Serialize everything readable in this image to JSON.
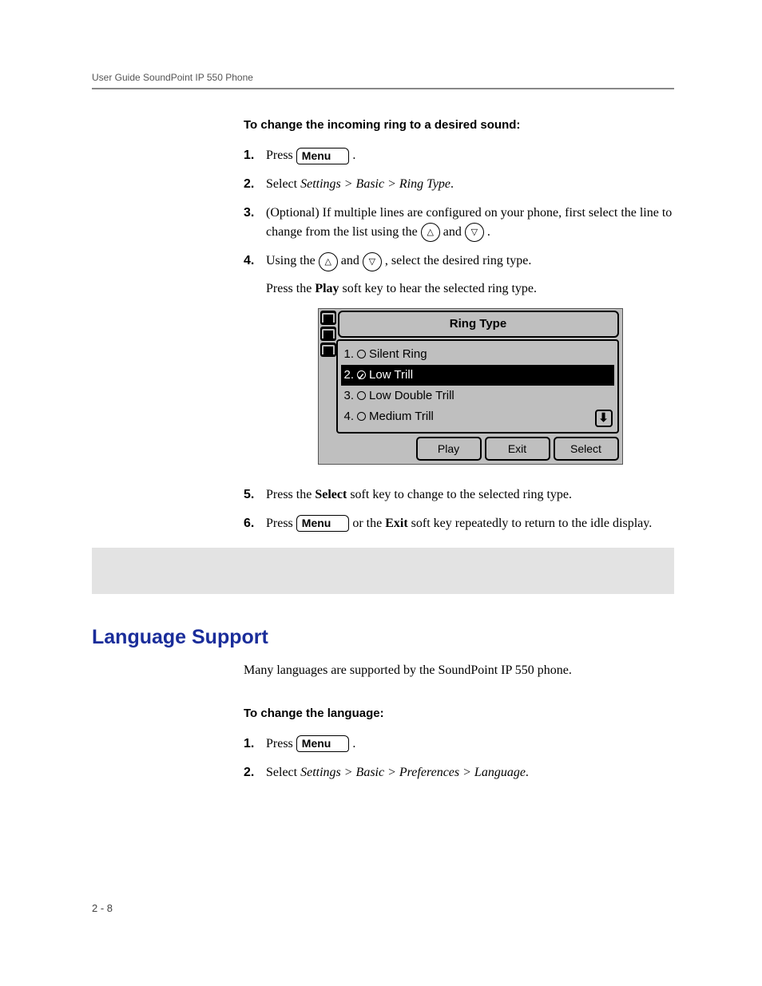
{
  "header": "User Guide SoundPoint IP 550 Phone",
  "footer_page": "2 - 8",
  "ring_section": {
    "heading": "To change the incoming ring to a desired sound:",
    "steps": {
      "s1_press": "Press ",
      "s1_menu": "Menu",
      "s1_end": " .",
      "s2_select_a": "Select ",
      "s2_select_b": "Settings > Basic > Ring Type",
      "s2_select_c": ".",
      "s3_a": "(Optional) If multiple lines are configured on your phone, first select the line to change from the list using the ",
      "s3_and": " and ",
      "s3_end": " .",
      "s4_a": "Using the ",
      "s4_and": " and ",
      "s4_b": " , select the desired ring type.",
      "s4_p2a": "Press the ",
      "s4_play": "Play",
      "s4_p2b": " soft key to hear the selected ring type.",
      "s5_a": "Press the ",
      "s5_select": "Select",
      "s5_b": " soft key to change to the selected ring type.",
      "s6_a": "Press ",
      "s6_menu": "Menu",
      "s6_b": " or the ",
      "s6_exit": "Exit",
      "s6_c": " soft key repeatedly to return to the idle display."
    }
  },
  "phone_screen": {
    "title": "Ring Type",
    "items": [
      {
        "num": "1.",
        "label": "Silent Ring",
        "selected": false,
        "checked": false
      },
      {
        "num": "2.",
        "label": "Low Trill",
        "selected": true,
        "checked": true
      },
      {
        "num": "3.",
        "label": "Low Double Trill",
        "selected": false,
        "checked": false
      },
      {
        "num": "4.",
        "label": "Medium Trill",
        "selected": false,
        "checked": false
      }
    ],
    "softkeys": [
      "Play",
      "Exit",
      "Select"
    ],
    "scroll_glyph": "⬇"
  },
  "lang_section": {
    "heading": "Language Support",
    "intro": "Many languages are supported by the SoundPoint IP 550 phone.",
    "sub_heading": "To change the language:",
    "steps": {
      "s1_press": "Press ",
      "s1_menu": "Menu",
      "s1_end": " .",
      "s2_a": "Select ",
      "s2_b": "Settings > Basic > Preferences > Language",
      "s2_c": "."
    }
  },
  "nums": {
    "n1": "1.",
    "n2": "2.",
    "n3": "3.",
    "n4": "4.",
    "n5": "5.",
    "n6": "6."
  },
  "arrows": {
    "up": "△",
    "down": "▽"
  }
}
